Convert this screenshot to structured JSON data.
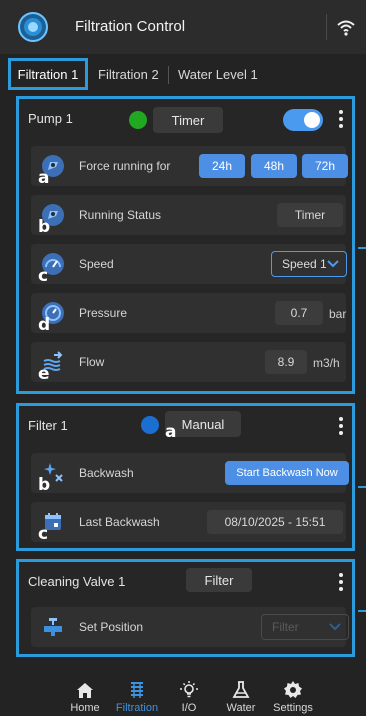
{
  "header": {
    "title": "Filtration Control"
  },
  "tabs": [
    {
      "label": "Filtration 1",
      "active": true
    },
    {
      "label": "Filtration 2",
      "active": false
    },
    {
      "label": "Water Level 1",
      "active": false
    }
  ],
  "pump": {
    "title": "Pump 1",
    "status_color": "#22a722",
    "mode_label": "Timer",
    "toggle_on": true,
    "rows": {
      "force": {
        "label": "Force running for",
        "letter": "a",
        "options": [
          "24h",
          "48h",
          "72h"
        ]
      },
      "status": {
        "label": "Running Status",
        "letter": "b",
        "value": "Timer"
      },
      "speed": {
        "label": "Speed",
        "letter": "c",
        "selected": "Speed 1"
      },
      "pressure": {
        "label": "Pressure",
        "letter": "d",
        "value": "0.7",
        "unit": "bar"
      },
      "flow": {
        "label": "Flow",
        "letter": "e",
        "value": "8.9",
        "unit": "m3/h"
      }
    }
  },
  "filter": {
    "title": "Filter 1",
    "status_color": "#1a6fd1",
    "mode_label": "Manual",
    "mode_letter": "a",
    "rows": {
      "backwash": {
        "label": "Backwash",
        "letter": "b",
        "button": "Start Backwash Now"
      },
      "last": {
        "label": "Last Backwash",
        "letter": "c",
        "value": "08/10/2025 - 15:51"
      }
    }
  },
  "valve": {
    "title": "Cleaning Valve 1",
    "mode_label": "Filter",
    "rows": {
      "position": {
        "label": "Set Position",
        "selected": "Filter"
      }
    }
  },
  "nav": [
    {
      "label": "Home",
      "icon": "home-icon",
      "active": false
    },
    {
      "label": "Filtration",
      "icon": "filtration-icon",
      "active": true
    },
    {
      "label": "I/O",
      "icon": "lightbulb-icon",
      "active": false
    },
    {
      "label": "Water",
      "icon": "flask-icon",
      "active": false
    },
    {
      "label": "Settings",
      "icon": "gear-icon",
      "active": false
    }
  ],
  "colors": {
    "accent": "#2b9bdc",
    "button_blue": "#4e8fe6",
    "background": "#232323"
  }
}
